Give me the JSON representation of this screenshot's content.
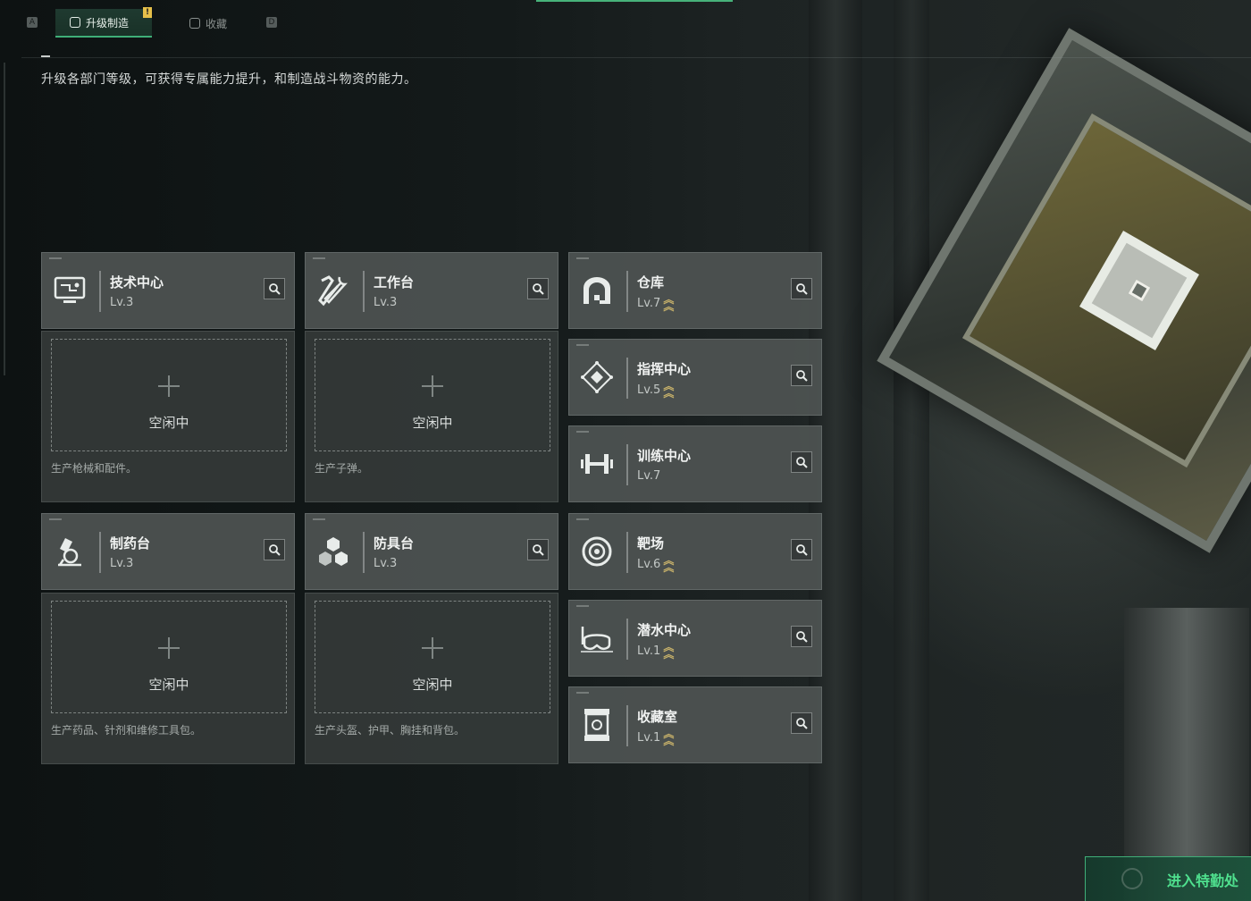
{
  "tabs": {
    "left_key": "A",
    "right_key": "D",
    "active_label": "升级制造",
    "inactive_label": "收藏",
    "alert_mark": "!"
  },
  "description": "升级各部门等级，可获得专属能力提升，和制造战斗物资的能力。",
  "crafting": [
    {
      "name": "技术中心",
      "level": "Lv.3",
      "icon": "monitor-icon",
      "idle_label": "空闲中",
      "note": "生产枪械和配件。"
    },
    {
      "name": "工作台",
      "level": "Lv.3",
      "icon": "hammer-wrench-icon",
      "idle_label": "空闲中",
      "note": "生产子弹。"
    },
    {
      "name": "制药台",
      "level": "Lv.3",
      "icon": "microscope-icon",
      "idle_label": "空闲中",
      "note": "生产药品、针剂和维修工具包。"
    },
    {
      "name": "防具台",
      "level": "Lv.3",
      "icon": "cubes-icon",
      "idle_label": "空闲中",
      "note": "生产头盔、护甲、胸挂和背包。"
    }
  ],
  "facilities": [
    {
      "name": "仓库",
      "level": "Lv.7",
      "icon": "warehouse-icon",
      "upgradable": true
    },
    {
      "name": "指挥中心",
      "level": "Lv.5",
      "icon": "command-diamond-icon",
      "upgradable": true
    },
    {
      "name": "训练中心",
      "level": "Lv.7",
      "icon": "dumbbell-icon",
      "upgradable": false
    },
    {
      "name": "靶场",
      "level": "Lv.6",
      "icon": "target-icon",
      "upgradable": true
    },
    {
      "name": "潜水中心",
      "level": "Lv.1",
      "icon": "diving-mask-icon",
      "upgradable": true
    },
    {
      "name": "收藏室",
      "level": "Lv.1",
      "icon": "collection-case-icon",
      "upgradable": true
    }
  ],
  "enter_button": "进入特勤处",
  "colors": {
    "accent": "#3fae78",
    "upgrade": "#c8b26a",
    "alert": "#e6c04a"
  }
}
